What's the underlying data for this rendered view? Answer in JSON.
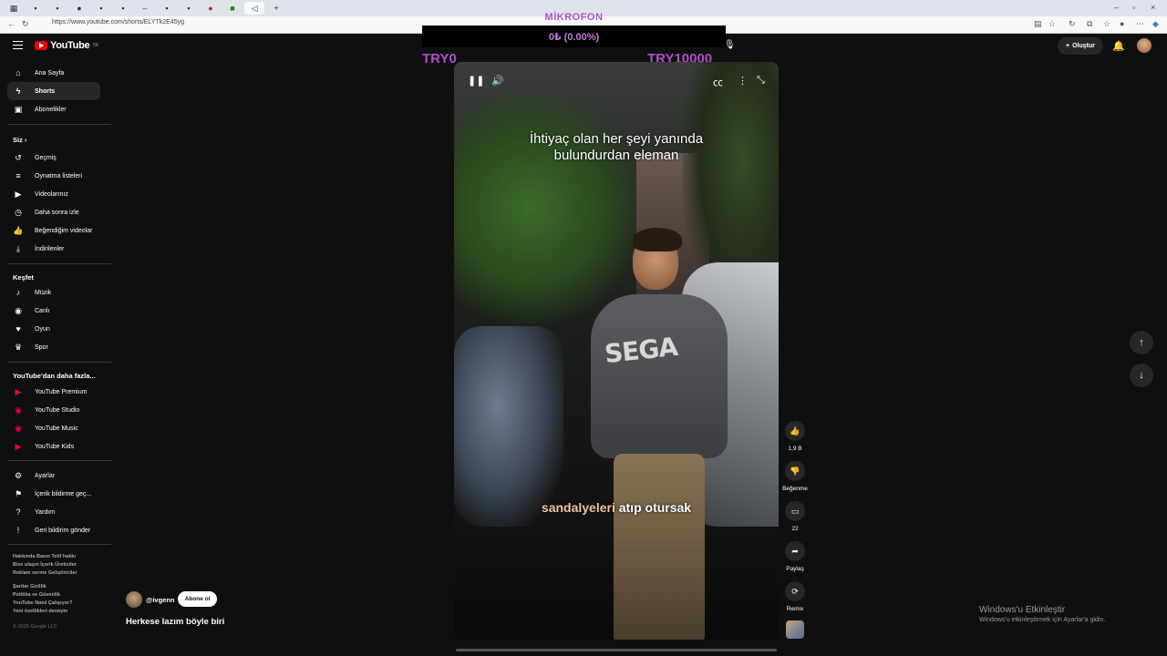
{
  "browser": {
    "url": "https://www.youtube.com/shorts/ELYTk2E45yg",
    "window_controls": [
      "–",
      "▫",
      "×"
    ]
  },
  "header": {
    "logo_text": "YouTube",
    "logo_region": "TR",
    "create_label": "Oluştur"
  },
  "overlay": {
    "title": "MİKROFON",
    "amount": "0₺ (0.00%)",
    "left_label": "TRY0",
    "right_label": "TRY10000"
  },
  "sidebar": {
    "main": [
      {
        "label": "Ana Sayfa",
        "icon": "home-icon"
      },
      {
        "label": "Shorts",
        "icon": "shorts-icon"
      },
      {
        "label": "Abonelikler",
        "icon": "subscriptions-icon"
      }
    ],
    "you_header": "Siz",
    "you": [
      {
        "label": "Geçmiş",
        "icon": "history-icon"
      },
      {
        "label": "Oynatma listeleri",
        "icon": "playlist-icon"
      },
      {
        "label": "Videolarınız",
        "icon": "your-videos-icon"
      },
      {
        "label": "Daha sonra izle",
        "icon": "clock-icon"
      },
      {
        "label": "Beğendiğim videolar",
        "icon": "thumb-up-icon"
      },
      {
        "label": "İndirilenler",
        "icon": "download-icon"
      }
    ],
    "explore_header": "Keşfet",
    "explore": [
      {
        "label": "Müzik",
        "icon": "music-icon"
      },
      {
        "label": "Canlı",
        "icon": "live-icon"
      },
      {
        "label": "Oyun",
        "icon": "gaming-icon"
      },
      {
        "label": "Spor",
        "icon": "trophy-icon"
      }
    ],
    "more_header": "YouTube'dan daha fazla...",
    "more": [
      {
        "label": "YouTube Premium",
        "icon": "youtube-premium-icon"
      },
      {
        "label": "YouTube Studio",
        "icon": "youtube-studio-icon"
      },
      {
        "label": "YouTube Music",
        "icon": "youtube-music-icon"
      },
      {
        "label": "YouTube Kids",
        "icon": "youtube-kids-icon"
      }
    ],
    "settings": [
      {
        "label": "Ayarlar",
        "icon": "gear-icon"
      },
      {
        "label": "İçerik bildirme geç...",
        "icon": "flag-icon"
      },
      {
        "label": "Yardım",
        "icon": "help-icon"
      },
      {
        "label": "Geri bildirim gönder",
        "icon": "feedback-icon"
      }
    ],
    "footer1": [
      "Hakkında  Basın  Telif hakkı",
      "Bize ulaşın  İçerik Üreticiler",
      "Reklam verme  Geliştiriciler"
    ],
    "footer2": [
      "Şartlar  Gizlilik",
      "Politika ve Güvenlik",
      "YouTube Nasıl Çalışıyor?",
      "Yeni özellikleri deneyin"
    ],
    "copyright": "© 2025 Google LLC"
  },
  "video": {
    "caption_top_1": "İhtiyaç olan her şeyi yanında",
    "caption_top_2": "bulundurdan eleman",
    "caption_bottom_hl": "sandalyeleri",
    "caption_bottom_rest": " atıp otursak",
    "shirt_text": "SEGA"
  },
  "actions": {
    "like_count": "1,9 B",
    "dislike_label": "Beğenme",
    "comment_count": "22",
    "share_label": "Paylaş",
    "remix_label": "Remix"
  },
  "channel": {
    "handle": "@ivgenn",
    "subscribe_label": "Abone ol",
    "video_title": "Herkese lazım böyle biri"
  },
  "windows_notice": {
    "title": "Windows'u Etkinleştir",
    "subtitle": "Windows'u etkinleştirmek için Ayarlar'a gidin."
  }
}
